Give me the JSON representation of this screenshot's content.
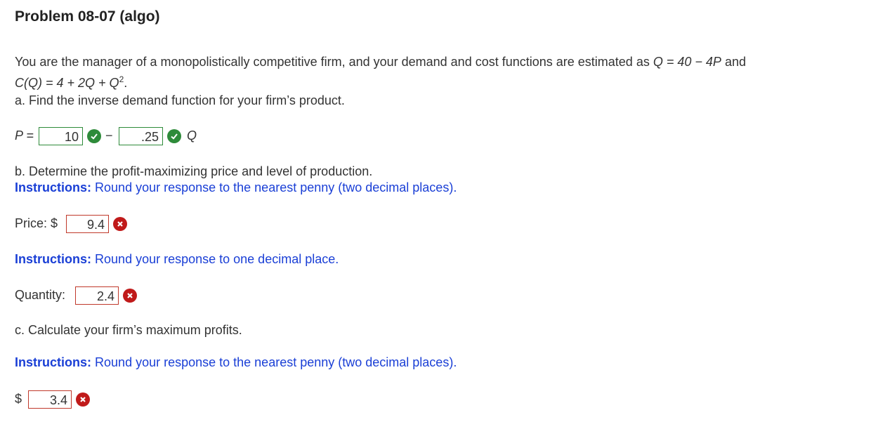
{
  "title": "Problem 08-07 (algo)",
  "intro": {
    "line1": "You are the manager of a monopolistically competitive firm, and your demand and cost functions are estimated as",
    "demand_eq": "Q = 40 − 4P",
    "and": "and",
    "cost_eq": "C(Q) = 4 + 2Q + Q",
    "cost_exp": "2",
    "cost_end": "."
  },
  "part_a": {
    "prompt": "a. Find the inverse demand function for your firm’s product.",
    "p_label": "P =",
    "intercept_value": "10",
    "minus": "−",
    "slope_value": ".25",
    "q_label": "Q",
    "intercept_status": "correct",
    "slope_status": "correct"
  },
  "part_b": {
    "prompt": "b. Determine the profit-maximizing price and level of production.",
    "instructions_label": "Instructions:",
    "instructions_price": "Round your response to the nearest penny (two decimal places).",
    "price_label": "Price: $",
    "price_value": "9.4",
    "price_status": "incorrect",
    "instructions_qty": "Round your response to one decimal place.",
    "quantity_label": "Quantity:",
    "quantity_value": "2.4",
    "quantity_status": "incorrect"
  },
  "part_c": {
    "prompt": "c. Calculate your firm’s maximum profits.",
    "instructions_label": "Instructions:",
    "instructions": "Round your response to the nearest penny (two decimal places).",
    "dollar": "$",
    "profit_value": "3.4",
    "profit_status": "incorrect"
  },
  "colors": {
    "correct": "#2e8b3a",
    "incorrect": "#c01a1a",
    "instructions": "#1a3fd6"
  }
}
